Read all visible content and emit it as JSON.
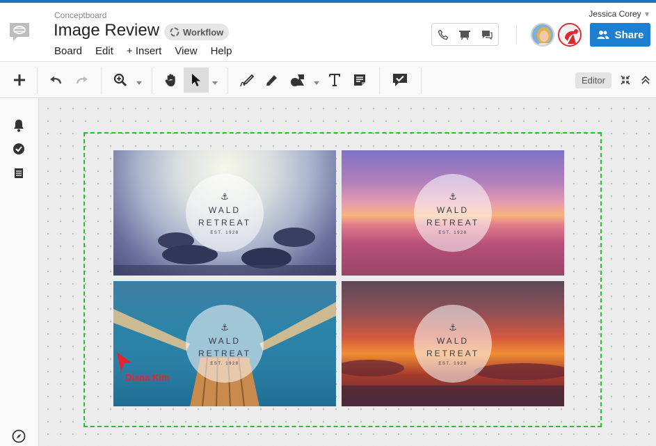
{
  "header": {
    "brand": "Conceptboard",
    "title": "Image Review",
    "workflow_label": "Workflow",
    "user_name": "Jessica Corey",
    "user_caret": "▾",
    "share_label": "Share"
  },
  "menu": {
    "items": [
      "Board",
      "Edit",
      "+ Insert",
      "View",
      "Help"
    ]
  },
  "toolbar": {
    "editor_label": "Editor"
  },
  "board": {
    "cards": [
      {
        "line1": "WALD",
        "line2": "RETREAT",
        "est": "EST. 1928"
      },
      {
        "line1": "WALD",
        "line2": "RETREAT",
        "est": "EST. 1928"
      },
      {
        "line1": "WALD",
        "line2": "RETREAT",
        "est": "EST. 1928"
      },
      {
        "line1": "WALD",
        "line2": "RETREAT",
        "est": "EST. 1928"
      }
    ],
    "anchor_glyph": "⚓",
    "cursor_user": "Diana Kim"
  },
  "colors": {
    "accent": "#1e7fd0",
    "selection": "#25c12a",
    "cursor": "#e2262f"
  }
}
